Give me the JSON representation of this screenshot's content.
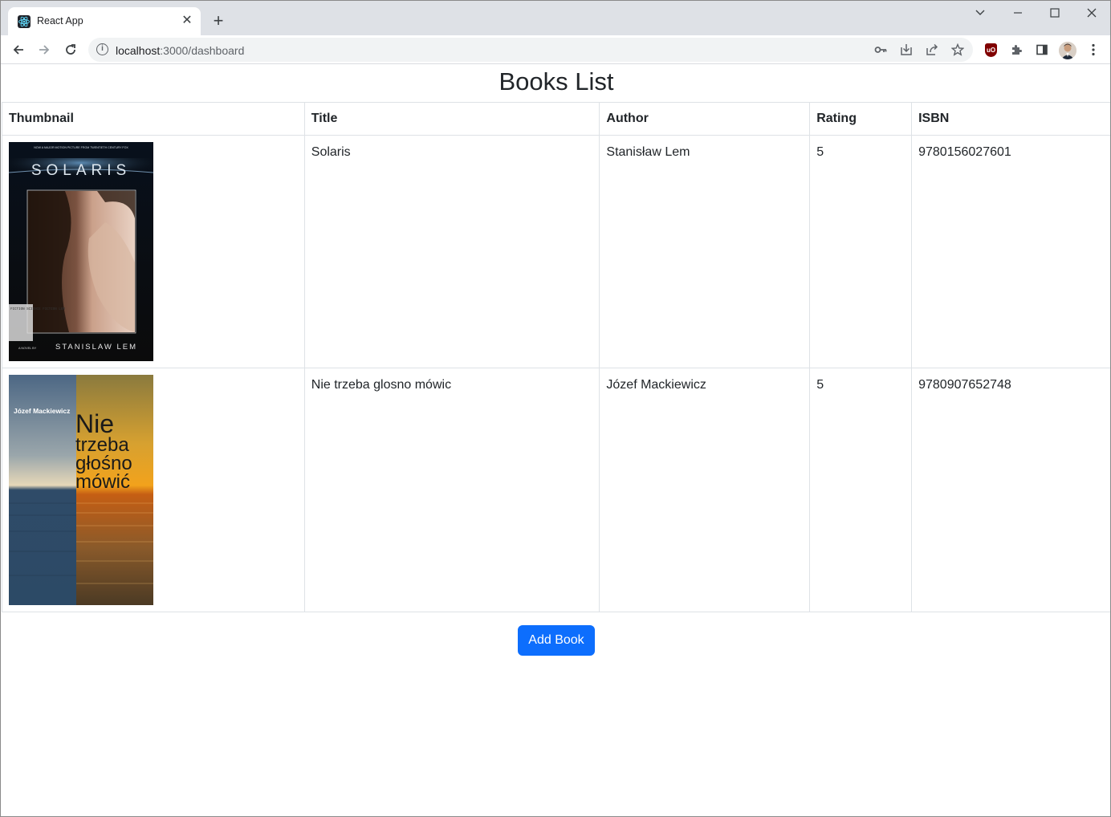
{
  "browser": {
    "tab_title": "React App",
    "tab_close": "✕",
    "new_tab": "+",
    "url_host": "localhost",
    "url_rest": ":3000/dashboard",
    "window_controls": {
      "dropdown": "⌄",
      "minimize": "—",
      "maximize": "☐",
      "close": "✕"
    }
  },
  "page": {
    "title": "Books List",
    "columns": [
      "Thumbnail",
      "Title",
      "Author",
      "Rating",
      "ISBN"
    ],
    "books": [
      {
        "title": "Solaris",
        "author": "Stanisław Lem",
        "rating": "5",
        "isbn": "9780156027601",
        "cover": {
          "top_text": "NOW A MAJOR MOTION PICTURE FROM TWENTIETH CENTURY FOX",
          "title": "SOLARIS",
          "label_text": "FICTION SCIENCE FICTION LEM",
          "byline": "A NOVEL BY",
          "author": "STANISLAW LEM"
        }
      },
      {
        "title": "Nie trzeba glosno mówic",
        "author": "Józef Mackiewicz",
        "rating": "5",
        "isbn": "9780907652748",
        "cover": {
          "author": "Józef Mackiewicz",
          "line1": "Nie",
          "line2": "trzeba",
          "line3": "głośno",
          "line4": "mówić"
        }
      }
    ],
    "add_button": "Add Book"
  },
  "colors": {
    "primary": "#0d6efd",
    "border": "#dee2e6",
    "text": "#212529",
    "tabstrip": "#dee1e6"
  }
}
